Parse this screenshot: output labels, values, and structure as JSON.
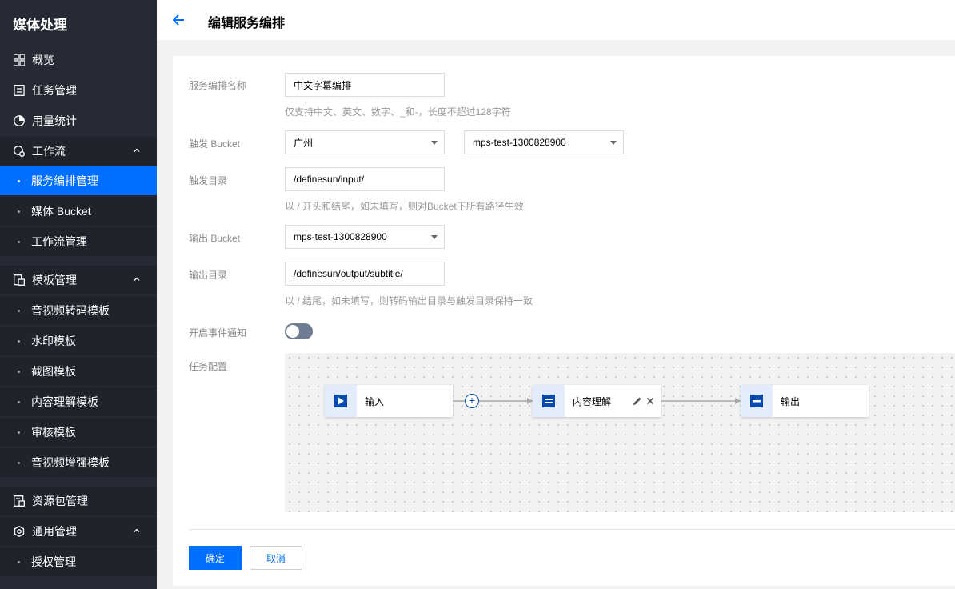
{
  "sidebar": {
    "title": "媒体处理",
    "items": [
      {
        "label": "概览",
        "icon": "grid-icon"
      },
      {
        "label": "任务管理",
        "icon": "document-icon"
      },
      {
        "label": "用量统计",
        "icon": "pie-chart-icon"
      },
      {
        "label": "工作流",
        "icon": "workflow-icon",
        "children": [
          "服务编排管理",
          "媒体 Bucket",
          "工作流管理"
        ]
      },
      {
        "label": "模板管理",
        "icon": "template-icon",
        "children": [
          "音视频转码模板",
          "水印模板",
          "截图模板",
          "内容理解模板",
          "审核模板",
          "音视频增强模板"
        ]
      },
      {
        "label": "资源包管理",
        "icon": "package-icon"
      },
      {
        "label": "通用管理",
        "icon": "settings-icon",
        "children": [
          "授权管理"
        ]
      }
    ],
    "active_item": "服务编排管理"
  },
  "header": {
    "title": "编辑服务编排"
  },
  "form": {
    "name_label": "服务编排名称",
    "name_value": "中文字幕编排",
    "name_hint": "仅支持中文、英文、数字、_和-，长度不超过128字符",
    "trigger_bucket_label": "触发 Bucket",
    "trigger_region": "广州",
    "trigger_bucket": "mps-test-1300828900",
    "trigger_dir_label": "触发目录",
    "trigger_dir_value": "/definesun/input/",
    "trigger_dir_hint": "以 / 开头和结尾，如未填写，则对Bucket下所有路径生效",
    "output_bucket_label": "输出 Bucket",
    "output_bucket": "mps-test-1300828900",
    "output_dir_label": "输出目录",
    "output_dir_value": "/definesun/output/subtitle/",
    "output_dir_hint": "以 / 结尾，如未填写，则转码输出目录与触发目录保持一致",
    "event_label": "开启事件通知",
    "event_enabled": false,
    "task_label": "任务配置"
  },
  "workflow": {
    "nodes": [
      {
        "label": "输入",
        "icon": "play-icon"
      },
      {
        "label": "内容理解",
        "icon": "content-understanding-icon"
      },
      {
        "label": "输出",
        "icon": "output-icon"
      }
    ]
  },
  "footer": {
    "confirm": "确定",
    "cancel": "取消"
  },
  "colors": {
    "accent": "#006eff",
    "sidebar_bg": "#262a35",
    "node_icon": "#0a4ab0"
  }
}
